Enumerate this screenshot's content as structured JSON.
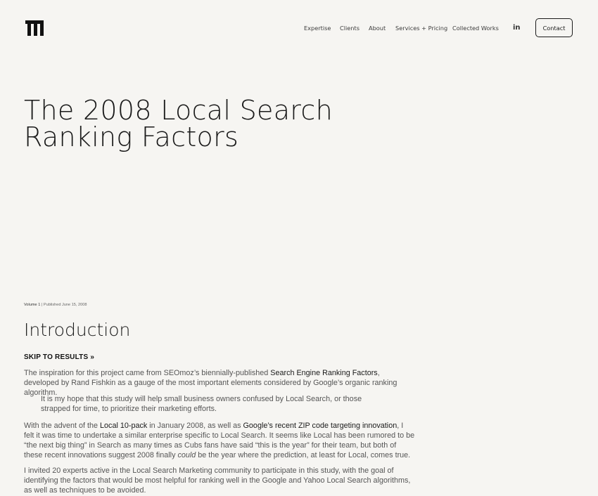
{
  "nav": {
    "items": [
      "Expertise",
      "Clients",
      "About",
      "Services + Pricing",
      "Collected Works"
    ],
    "linkedin_label": "in",
    "contact_label": "Contact"
  },
  "article": {
    "title": "The 2008 Local Search Ranking Factors",
    "meta": {
      "volume": "Volume 1",
      "published": " | Published June 15, 2008"
    },
    "section_heading": "Introduction",
    "skip_link": "SKIP TO RESULTS »",
    "p1": {
      "a": "The inspiration for this project came from SEOmoz’s biennially-published ",
      "link": "Search Engine Ranking Factors",
      "b": ", developed by Rand Fishkin as a gauge of the most important elements considered by Google’s organic ranking algorithm."
    },
    "quote": "It is my hope that this study will help small business owners confused by Local Search, or those strapped for time, to prioritize their marketing efforts.",
    "p2": {
      "a": "With the advent of the ",
      "link1": "Local 10-pack",
      "b": " in January 2008, as well as ",
      "link2": "Google’s recent ZIP code targeting innovation",
      "c": ", I felt it was time to undertake a similar enterprise specific to Local Search. It seems like Local has been rumored to be “the next big thing” in Search as many times as Cubs fans have said “this is the year” for their team, but both of these recent innovations suggest 2008 finally ",
      "em": "could",
      "d": " be the year where the prediction, at least for Local, comes true."
    },
    "p3": "I invited 20 experts active in the Local Search Marketing community to participate in this study, with the goal of identifying the factors that would be most helpful for ranking well in the Google and Yahoo Local Search algorithms, as well as techniques to be avoided."
  }
}
